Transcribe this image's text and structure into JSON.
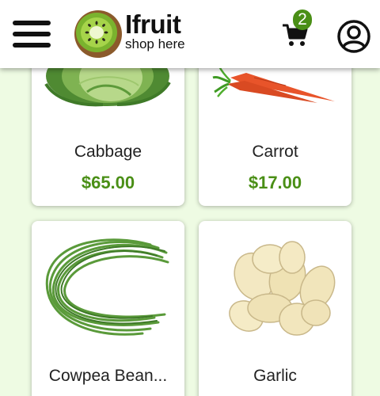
{
  "header": {
    "brand_name": "Ifruit",
    "tagline": "shop here",
    "cart_count": "2"
  },
  "colors": {
    "accent": "#4a8f16",
    "background": "#eefbe3"
  },
  "products": [
    {
      "name": "Cabbage",
      "price": "$65.00"
    },
    {
      "name": "Carrot",
      "price": "$17.00"
    },
    {
      "name": "Cowpea Bean...",
      "price": ""
    },
    {
      "name": "Garlic",
      "price": ""
    }
  ]
}
